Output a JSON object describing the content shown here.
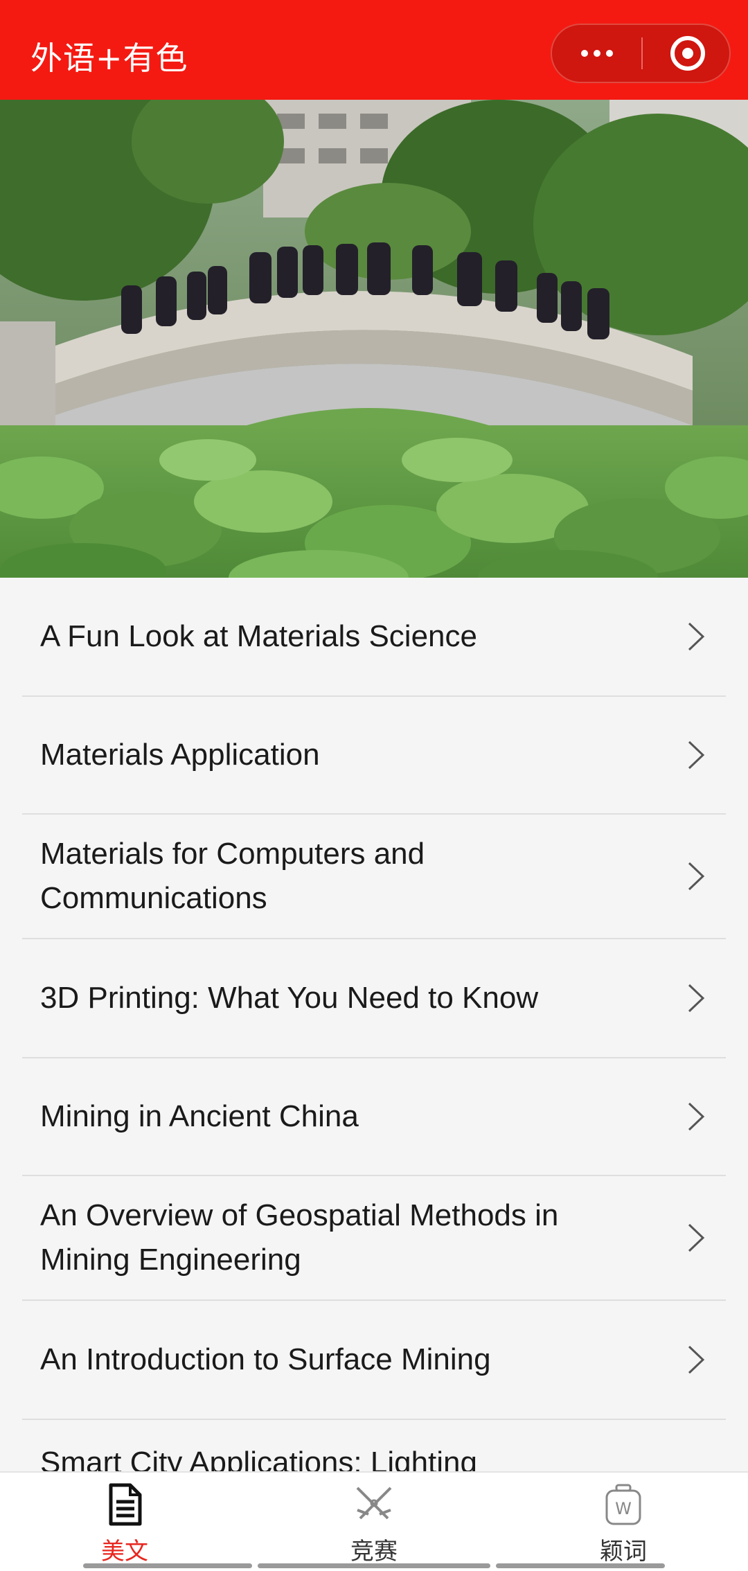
{
  "header": {
    "title": "外语+有色",
    "background_color": "#f41a12",
    "more_icon": "more-dots-icon",
    "close_icon": "target-circle-icon"
  },
  "list": {
    "items": [
      {
        "label": "A Fun Look at Materials Science"
      },
      {
        "label": "Materials Application"
      },
      {
        "label": "Materials for Computers and Communications"
      },
      {
        "label": "3D Printing: What You Need to Know"
      },
      {
        "label": "Mining in Ancient China"
      },
      {
        "label": "An Overview of Geospatial Methods in Mining Engineering"
      },
      {
        "label": "An Introduction to Surface Mining"
      },
      {
        "label": "Smart City Applications: Lighting"
      }
    ]
  },
  "tabbar": {
    "active_color": "#e8261f",
    "tabs": [
      {
        "label": "美文",
        "icon": "document-icon",
        "active": true
      },
      {
        "label": "竞赛",
        "icon": "crossed-swords-icon",
        "active": false
      },
      {
        "label": "颖词",
        "icon": "word-jar-icon",
        "active": false
      }
    ]
  }
}
